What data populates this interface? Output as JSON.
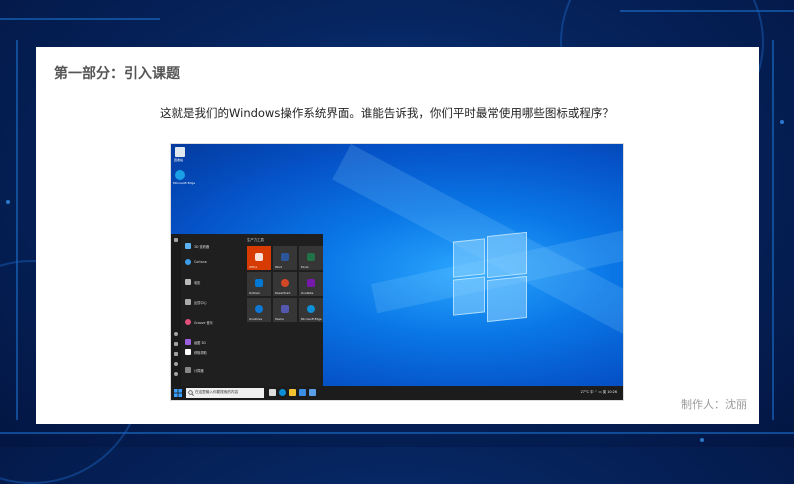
{
  "slide": {
    "title": "第一部分：引入课题",
    "subtitle": "这就是我们的Windows操作系统界面。谁能告诉我，你们平时最常使用哪些图标或程序？",
    "author": "制作人：沈丽"
  },
  "windows": {
    "start_menu": {
      "tiles_header": "生产力工具",
      "tiles": [
        {
          "label": "Office",
          "color": "#d83b01",
          "icon": "office-icon"
        },
        {
          "label": "Word",
          "color": "#2b579a",
          "icon": "word-icon"
        },
        {
          "label": "Excel",
          "color": "#217346",
          "icon": "excel-icon"
        },
        {
          "label": "Outlook",
          "color": "#0078d4",
          "icon": "outlook-icon"
        },
        {
          "label": "PowerPoint",
          "color": "#d24726",
          "icon": "powerpoint-icon"
        },
        {
          "label": "OneNote",
          "color": "#7719aa",
          "icon": "onenote-icon"
        },
        {
          "label": "OneDrive",
          "color": "#0f78d4",
          "icon": "onedrive-icon"
        },
        {
          "label": "Teams",
          "color": "#5558af",
          "icon": "teams-icon"
        },
        {
          "label": "Microsoft Edge",
          "color": "#0c8fd6",
          "icon": "edge-icon"
        }
      ],
      "apps": [
        {
          "label": "3D 查看器",
          "color": "#5ab3f0"
        },
        {
          "label": "Cortana",
          "color": "#3d9de8"
        },
        {
          "label": "电影",
          "color": "#bbbbbb"
        },
        {
          "label": "反馈中心",
          "color": "#aaaaaa"
        },
        {
          "label": "Groove 音乐",
          "color": "#e14f7b"
        },
        {
          "label": "画图 3D",
          "color": "#9b5fe0"
        },
        {
          "label": "获取帮助",
          "color": "#ffffff"
        },
        {
          "label": "计算器",
          "color": "#888888"
        }
      ]
    },
    "taskbar": {
      "search_placeholder": "在这里输入你要搜索的内容",
      "tray_text": "27°C 中 ⌃ ▭ 英",
      "time": "10:26"
    },
    "desktop_icons": [
      "回收站",
      "Microsoft Edge"
    ]
  }
}
